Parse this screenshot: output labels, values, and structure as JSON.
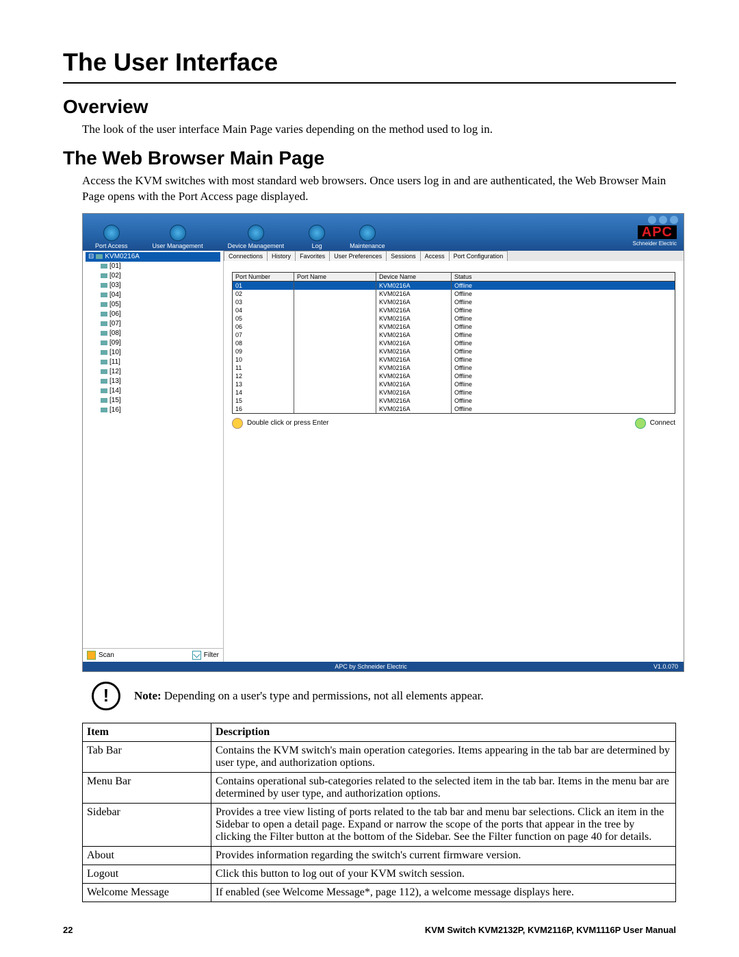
{
  "headings": {
    "h1": "The User Interface",
    "h2a": "Overview",
    "h2b": "The Web Browser Main Page"
  },
  "paragraphs": {
    "overview": "The look of the user interface Main Page varies depending on the method used to log in.",
    "web_intro": "Access the KVM switches with most standard web browsers. Once users log in and are authenticated, the Web Browser Main Page opens with the Port Access page displayed."
  },
  "screenshot": {
    "tabs": [
      "Port Access",
      "User Management",
      "Device Management",
      "Log",
      "Maintenance"
    ],
    "logo_top": "APC",
    "logo_bottom": "Schneider Electric",
    "root": "KVM0216A",
    "sidebar": [
      "[01]",
      "[02]",
      "[03]",
      "[04]",
      "[05]",
      "[06]",
      "[07]",
      "[08]",
      "[09]",
      "[10]",
      "[11]",
      "[12]",
      "[13]",
      "[14]",
      "[15]",
      "[16]"
    ],
    "scan": "Scan",
    "filter": "Filter",
    "subtabs": [
      "Connections",
      "History",
      "Favorites",
      "User Preferences",
      "Sessions",
      "Access",
      "Port Configuration"
    ],
    "table": {
      "headers": [
        "Port Number",
        "Port Name",
        "Device Name",
        "Status"
      ],
      "rows": [
        [
          "01",
          "",
          "KVM0216A",
          "Offline"
        ],
        [
          "02",
          "",
          "KVM0216A",
          "Offline"
        ],
        [
          "03",
          "",
          "KVM0216A",
          "Offline"
        ],
        [
          "04",
          "",
          "KVM0216A",
          "Offline"
        ],
        [
          "05",
          "",
          "KVM0216A",
          "Offline"
        ],
        [
          "06",
          "",
          "KVM0216A",
          "Offline"
        ],
        [
          "07",
          "",
          "KVM0216A",
          "Offline"
        ],
        [
          "08",
          "",
          "KVM0216A",
          "Offline"
        ],
        [
          "09",
          "",
          "KVM0216A",
          "Offline"
        ],
        [
          "10",
          "",
          "KVM0216A",
          "Offline"
        ],
        [
          "11",
          "",
          "KVM0216A",
          "Offline"
        ],
        [
          "12",
          "",
          "KVM0216A",
          "Offline"
        ],
        [
          "13",
          "",
          "KVM0216A",
          "Offline"
        ],
        [
          "14",
          "",
          "KVM0216A",
          "Offline"
        ],
        [
          "15",
          "",
          "KVM0216A",
          "Offline"
        ],
        [
          "16",
          "",
          "KVM0216A",
          "Offline"
        ]
      ]
    },
    "hint": "Double click or press Enter",
    "connect": "Connect",
    "footer_left": "APC by Schneider Electric",
    "footer_right": "V1.0.070"
  },
  "note": {
    "label": "Note:",
    "text": " Depending on a user's type and permissions, not all elements appear."
  },
  "desc_table": {
    "headers": [
      "Item",
      "Description"
    ],
    "rows": [
      [
        "Tab Bar",
        "Contains the KVM switch's main operation categories. Items appearing in the tab bar are determined by user type, and authorization options."
      ],
      [
        "Menu Bar",
        "Contains operational sub-categories related to the selected item in the tab bar. Items in the menu bar are determined by user type, and authorization options."
      ],
      [
        "Sidebar",
        "Provides a tree view listing of ports related to the tab bar and menu bar selections. Click an item in the Sidebar to open a detail page. Expand or narrow the scope of the ports that appear in the tree by clicking the Filter button at the bottom of the Sidebar. See the Filter function on page 40 for details."
      ],
      [
        "About",
        "Provides information regarding the switch's current firmware version."
      ],
      [
        "Logout",
        "Click this button to log out of your KVM switch session."
      ],
      [
        "Welcome Message",
        "If enabled (see Welcome Message*, page 112), a welcome message displays here."
      ]
    ]
  },
  "page_footer": {
    "num": "22",
    "title": "KVM Switch KVM2132P, KVM2116P, KVM1116P User Manual"
  }
}
